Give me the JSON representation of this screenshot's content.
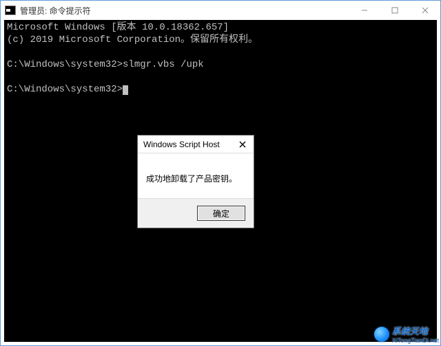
{
  "window": {
    "title": "管理员: 命令提示符"
  },
  "terminal": {
    "line1": "Microsoft Windows [版本 10.0.18362.657]",
    "line2": "(c) 2019 Microsoft Corporation。保留所有权利。",
    "prompt1_path": "C:\\Windows\\system32>",
    "prompt1_cmd": "slmgr.vbs /upk",
    "prompt2_path": "C:\\Windows\\system32>"
  },
  "dialog": {
    "title": "Windows Script Host",
    "message": "成功地卸载了产品密钥。",
    "ok_label": "确定"
  },
  "watermark": {
    "name": "系统天地",
    "url": "XiTongTianDi.net"
  }
}
